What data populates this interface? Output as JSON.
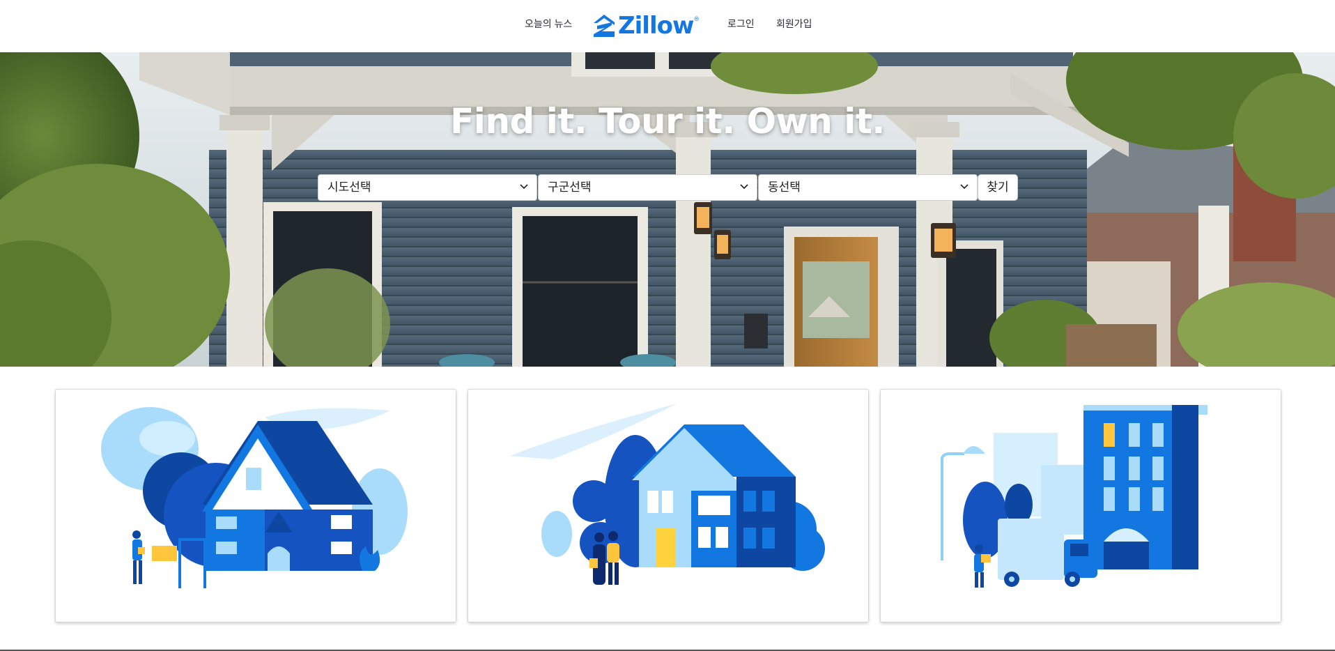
{
  "header": {
    "nav_left": "오늘의 뉴스",
    "logo_text": "Zillow",
    "logo_mark": "®",
    "login": "로그인",
    "signup": "회원가입"
  },
  "hero": {
    "title": "Find it. Tour it. Own it.",
    "selects": [
      {
        "value": "시도선택"
      },
      {
        "value": "구군선택"
      },
      {
        "value": "동선택"
      }
    ],
    "find_button": "찾기"
  },
  "colors": {
    "brand_blue": "#1277e1",
    "dark_blue": "#0d47a1",
    "light_blue": "#b8e3ff",
    "accent_yellow": "#ffc53d"
  },
  "cards": [
    {
      "illustration": "house-with-for-sale-sign"
    },
    {
      "illustration": "couple-in-front-of-house"
    },
    {
      "illustration": "moving-truck-apartment-building"
    }
  ]
}
